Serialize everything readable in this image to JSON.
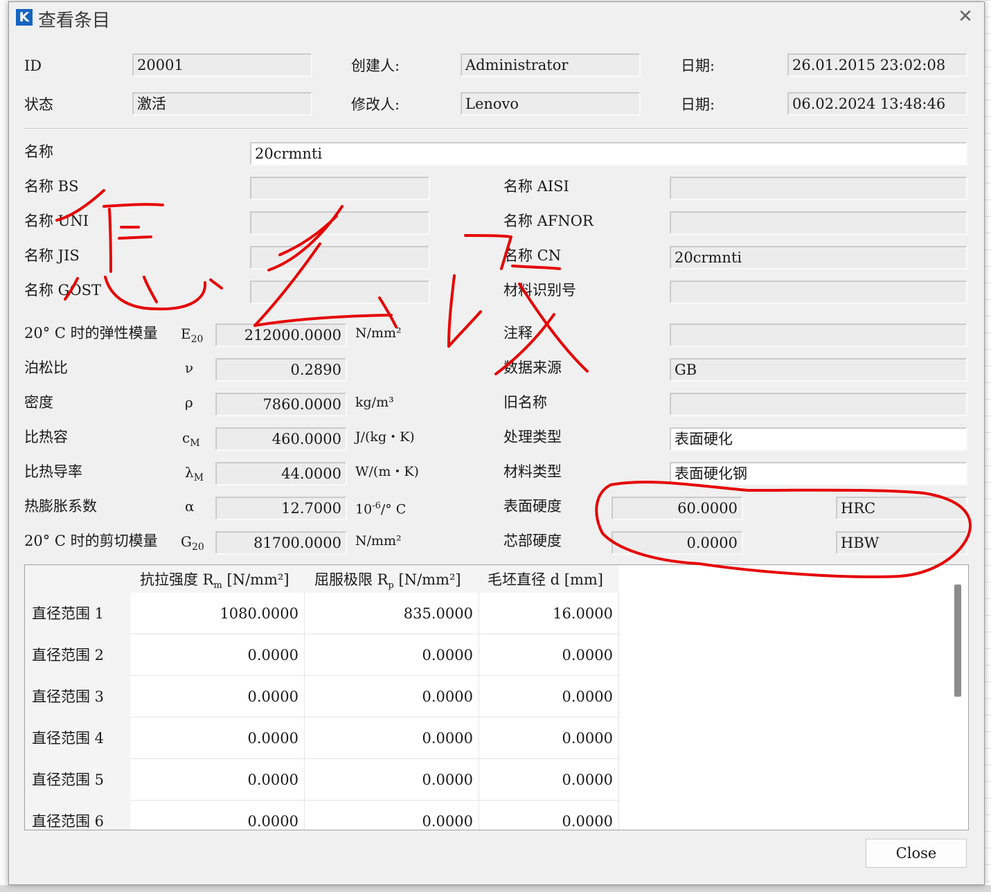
{
  "window": {
    "icon": "K",
    "title": "查看条目",
    "close_glyph": "✕"
  },
  "header": {
    "id_label": "ID",
    "id_value": "20001",
    "creator_label": "创建人:",
    "creator_value": "Administrator",
    "date1_label": "日期:",
    "date1_value": "26.01.2015 23:02:08",
    "status_label": "状态",
    "status_value": "激活",
    "modifier_label": "修改人:",
    "modifier_value": "Lenovo",
    "date2_label": "日期:",
    "date2_value": "06.02.2024 13:48:46"
  },
  "names": {
    "name_label": "名称",
    "name_value": "20crmnti",
    "bs_label": "名称 BS",
    "bs_value": "",
    "uni_label": "名称 UNI",
    "uni_value": "",
    "jis_label": "名称 JIS",
    "jis_value": "",
    "gost_label": "名称 GOST",
    "gost_value": "",
    "aisi_label": "名称 AISI",
    "aisi_value": "",
    "afnor_label": "名称 AFNOR",
    "afnor_value": "",
    "cn_label": "名称 CN",
    "cn_value": "20crmnti",
    "matid_label": "材料识别号",
    "matid_value": ""
  },
  "props": {
    "e20_label": "20° C 时的弹性模量",
    "e20_sym": "E",
    "e20_sub": "20",
    "e20_value": "212000.0000",
    "e20_unit": "N/mm²",
    "poisson_label": "泊松比",
    "poisson_sym": "ν",
    "poisson_value": "0.2890",
    "density_label": "密度",
    "density_sym": "ρ",
    "density_value": "7860.0000",
    "density_unit": "kg/m³",
    "heat_label": "比热容",
    "heat_sym": "c",
    "heat_sub": "M",
    "heat_value": "460.0000",
    "heat_unit": "J/(kg・K)",
    "cond_label": "比热导率",
    "cond_sym": "λ",
    "cond_sub": "M",
    "cond_value": "44.0000",
    "cond_unit": "W/(m・K)",
    "exp_label": "热膨胀系数",
    "exp_sym": "α",
    "exp_value": "12.7000",
    "exp_unit_base": "10",
    "exp_unit_sup": "-6",
    "exp_unit_rest": "/° C",
    "g20_label": "20° C 时的剪切模量",
    "g20_sym": "G",
    "g20_sub": "20",
    "g20_value": "81700.0000",
    "g20_unit": "N/mm²"
  },
  "right": {
    "comment_label": "注释",
    "comment_value": "",
    "source_label": "数据来源",
    "source_value": "GB",
    "oldname_label": "旧名称",
    "oldname_value": "",
    "treat_label": "处理类型",
    "treat_value": "表面硬化",
    "mattype_label": "材料类型",
    "mattype_value": "表面硬化钢",
    "surf_label": "表面硬度",
    "surf_value": "60.0000",
    "surf_unit": "HRC",
    "core_label": "芯部硬度",
    "core_value": "0.0000",
    "core_unit": "HBW"
  },
  "table": {
    "col1_base": "抗拉强度 R",
    "col1_sub": "m",
    "col1_unit": " [N/mm²]",
    "col2_base": "屈服极限 R",
    "col2_sub": "p",
    "col2_unit": " [N/mm²]",
    "col3": "毛坯直径 d [mm]",
    "rows": [
      {
        "label": "直径范围 1",
        "rm": "1080.0000",
        "rp": "835.0000",
        "d": "16.0000"
      },
      {
        "label": "直径范围 2",
        "rm": "0.0000",
        "rp": "0.0000",
        "d": "0.0000"
      },
      {
        "label": "直径范围 3",
        "rm": "0.0000",
        "rp": "0.0000",
        "d": "0.0000"
      },
      {
        "label": "直径范围 4",
        "rm": "0.0000",
        "rp": "0.0000",
        "d": "0.0000"
      },
      {
        "label": "直径范围 5",
        "rm": "0.0000",
        "rp": "0.0000",
        "d": "0.0000"
      },
      {
        "label": "直径范围 6",
        "rm": "0.0000",
        "rp": "0.0000",
        "d": "0.0000"
      }
    ]
  },
  "buttons": {
    "close": "Close"
  },
  "annotation": {
    "color": "#e60000",
    "handwriting": "怎么改"
  }
}
